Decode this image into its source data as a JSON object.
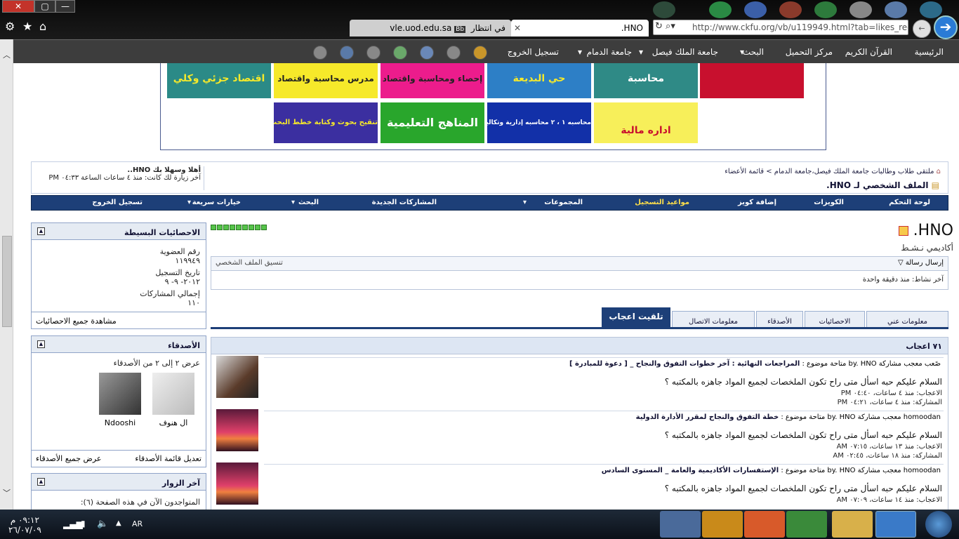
{
  "window": {
    "close": "✕",
    "maximize": "▢",
    "minimize": "—"
  },
  "browser": {
    "tabs": [
      {
        "label": "في انتظار vle.uod.edu.sa",
        "badge": "Bb"
      },
      {
        "label": "HNO."
      }
    ],
    "url": "http://www.ckfu.org/vb/u119949.html?tab=likes_recei"
  },
  "forum_nav": {
    "items": [
      "الرئيسية",
      "القرآن الكريم",
      "مركز التحميل",
      "البحث",
      "جامعة الملك فيصل",
      "جامعة الدمام",
      "تسجيل الخروج"
    ]
  },
  "banner": {
    "tiles": [
      {
        "text": "",
        "bg": "#c8102e"
      },
      {
        "text": "محاسبة",
        "bg": "#2f8a86"
      },
      {
        "text": "حي البديعة",
        "bg": "#2d7fc6"
      },
      {
        "text": "إحصاء ومحاسبة واقتصاد",
        "bg": "#ec1c8c"
      },
      {
        "text": "مدرس محاسبة واقتصاد",
        "bg": "#f6e92a"
      },
      {
        "text": "اقتصاد جزئي وكلي",
        "bg": "#2b8a87"
      },
      {
        "text": "اداره مالية",
        "bg": "#f7ef5a"
      },
      {
        "text": "محاسبه ١ ، ٢ محاسبه إدارية وتكاليف",
        "bg": "#1230a8"
      },
      {
        "text": "المناهج التعليمية",
        "bg": "#29a62c"
      },
      {
        "text": "تنقيح بحوث وكتابة خطط البحث",
        "bg": "#3b2fa0"
      }
    ]
  },
  "breadcrumb": {
    "path": "ملتقى طلاب وطالبات جامعة الملك فيصل،جامعة الدمام > قائمة الأعضاء",
    "title": "الملف الشخصي لـ HNO.",
    "welcome": "أهلا وسهلا بك HNO..",
    "last_visit": "آخر زيارة لك كانت: منذ ٤ ساعات الساعة ٠٤:٣٣ PM"
  },
  "blue_nav": [
    "لوحة التحكم",
    "الكويزات",
    "إضافة كويز",
    "مواعيد التسجيل",
    "المجموعات",
    "المشاركات الجديدة",
    "البحث",
    "خيارات سريعة",
    "تسجيل الخروج"
  ],
  "sidebar": {
    "stats": {
      "title": "الاحصائيات البسيطة",
      "member_no_label": "رقم العضوية",
      "member_no": "١١٩٩٤٩",
      "reg_label": "تاريخ التسجيل",
      "reg_date": "٢٠١٢- ٩- ٩",
      "posts_label": "إجمالي المشاركات",
      "posts": "١١٠",
      "view_all": "مشاهدة جميع الاحصائيات"
    },
    "friends": {
      "title": "الأصدقاء",
      "showing": "عرض ٢ إلى ٢ من الأصدقاء",
      "list": [
        "ال هنوف",
        "Ndooshi"
      ],
      "edit": "تعديل قائمة الأصدقاء",
      "view_all": "عرض جميع الأصدقاء"
    },
    "visitors": {
      "title": "آخر الزوار",
      "online": "المتواجدون الآن في هذه الصفحة (٦):"
    }
  },
  "profile": {
    "name": "HNO.",
    "status": "أكاديمي نـشـط",
    "send_msg": "إرسال رسالة",
    "coord": "تنسيق الملف الشخصي",
    "last_activity": "آخر نشاط: منذ دقيقة واحدة"
  },
  "profile_tabs": [
    "معلومات عني",
    "الاحصائيات",
    "الأصدقاء",
    "معلومات الاتصال",
    "تلقيت اعجاب"
  ],
  "likes": {
    "title": "٧١ اعجاب",
    "items": [
      {
        "header_user": "صًعب معجب مشاركة",
        "by": "by. HNO",
        "subject_prefix": "متاحة موضوع :",
        "subject": "المراجعات النهائية : آخر خطوات التفوق والنجاح _ [ دعوة للمبادرة ]",
        "text": "السلام عليكم حبه اسأل متى راح تكون الملخصات لجميع المواد جاهزه بالمكتبه ؟",
        "liked": "الاعجاب: منذ ٤ ساعات، ٠٤:٤٠ PM",
        "posted": "المشاركة: منذ ٤ ساعات، ٠٤:٢١ PM"
      },
      {
        "header_user": "homoodan معجب مشاركة",
        "by": "by. HNO",
        "subject_prefix": "متاحة موضوع :",
        "subject": "خطة التفوق والنجاح لمقرر الأدارة الدولية",
        "text": "السلام عليكم حبه اسأل متى راح تكون الملخصات لجميع المواد جاهزه بالمكتبه ؟",
        "liked": "الاعجاب: منذ ١٣ ساعات، ٠٧:١٥ AM",
        "posted": "المشاركة: منذ ١٨ ساعات، ٠٢:٤٥ AM"
      },
      {
        "header_user": "homoodan معجب مشاركة",
        "by": "by. HNO",
        "subject_prefix": "متاحة موضوع :",
        "subject": "الإستفسارات الأكاديمية والعامة _ المستوى السادس",
        "text": "السلام عليكم حبه اسأل متى راح تكون الملخصات لجميع المواد جاهزه بالمكتبه ؟",
        "liked": "الاعجاب: منذ ١٤ ساعات، ٠٧:٠٩ AM",
        "posted": ""
      }
    ]
  },
  "taskbar": {
    "time": "٠٩:١٢ م",
    "date": "٢٦/٠٧/٠٩",
    "lang": "AR"
  }
}
